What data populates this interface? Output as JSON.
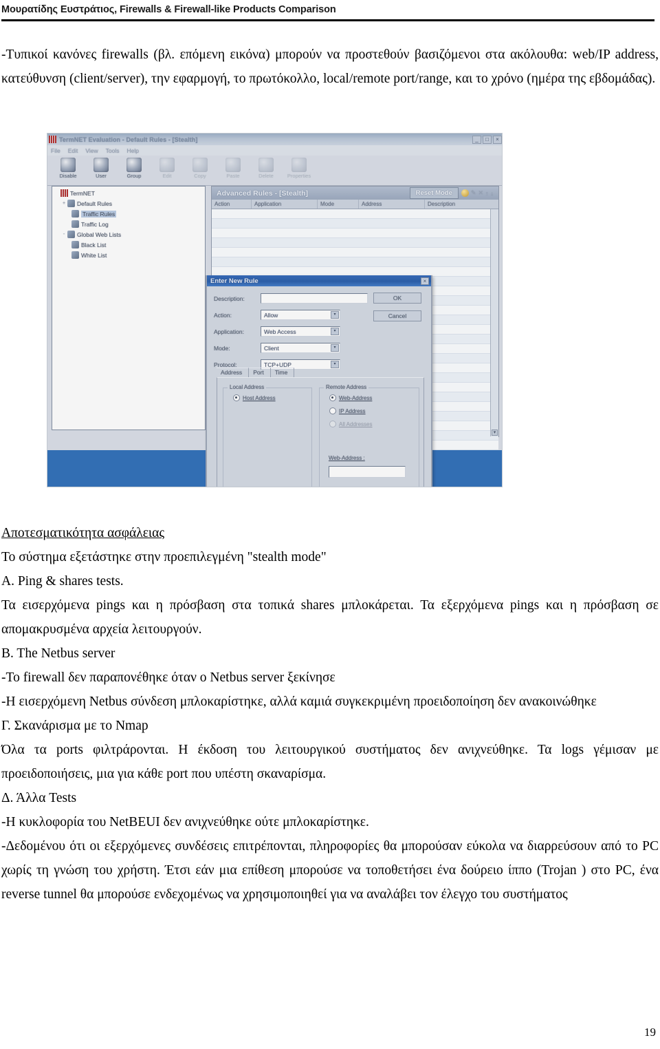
{
  "header": {
    "running_head": "Μουρατίδης Ευστράτιος, Firewalls & Firewall-like Products Comparison"
  },
  "page_number": "19",
  "paragraphs": {
    "intro": "-Τυπικοί κανόνες firewalls (βλ. επόμενη εικόνα) μπορούν να προστεθούν βασιζόμενοι στα ακόλουθα: web/IP address, κατεύθυνση (client/server),  την εφαρμογή, το πρωτόκολλο, local/remote port/range, και το χρόνο (ημέρα της εβδομάδας).",
    "section_security_heading": "Αποτεσματικότητα ασφάλειας",
    "stealth_line": "Το σύστημα εξετάστηκε στην προεπιλεγμένη  \"stealth mode\"",
    "a_heading": "A. Ping & shares tests.",
    "a_body": "Τα εισερχόμενα pings και η πρόσβαση στα τοπικά shares μπλοκάρεται. Τα εξερχόμενα pings και η πρόσβαση σε απομακρυσμένα αρχεία λειτουργούν.",
    "b_heading": "B. The Netbus server",
    "b_line1": "-Το firewall δεν παραπονέθηκε όταν ο Netbus server ξεκίνησε",
    "b_line2": "-Η εισερχόμενη Netbus σύνδεση μπλοκαρίστηκε, αλλά καμιά συγκεκριμένη προειδοποίηση δεν ανακοινώθηκε",
    "c_heading": "Γ. Σκανάρισμα με το Nmap",
    "c_body": "Όλα τα ports φιλτράρονται. Η έκδοση του λειτουργικού συστήματος δεν ανιχνεύθηκε. Τα logs γέμισαν με προειδοποιήσεις, μια για κάθε port που υπέστη σκαναρίσμα.",
    "d_heading": "Δ. Άλλα Tests",
    "d_line1": "-Η κυκλοφορία του NetBEUI δεν ανιχνεύθηκε ούτε μπλοκαρίστηκε.",
    "d_line2": "-Δεδομένου ότι οι εξερχόμενες συνδέσεις επιτρέπονται, πληροφορίες θα μπορούσαν εύκολα να διαρρεύσουν από το PC χωρίς τη γνώση του χρήστη. Έτσι εάν μια επίθεση μπορούσε να τοποθετήσει ένα δούρειο ίππο (Trojan ) στο PC, ένα reverse tunnel θα μπορούσε ενδεχομένως να χρησιμοποιηθεί για να αναλάβει τον έλεγχο του συστήματος"
  },
  "figure": {
    "window": {
      "title": "TermNET Evaluation - Default Rules - [Stealth]",
      "menu": [
        "File",
        "Edit",
        "View",
        "Tools",
        "Help"
      ],
      "caption_buttons": [
        "_",
        "□",
        "×"
      ],
      "toolbar": [
        {
          "label": "Disable",
          "enabled": true
        },
        {
          "label": "User",
          "enabled": true
        },
        {
          "label": "Group",
          "enabled": true
        },
        {
          "label": "Edit",
          "enabled": false
        },
        {
          "label": "Copy",
          "enabled": false
        },
        {
          "label": "Paste",
          "enabled": false
        },
        {
          "label": "Delete",
          "enabled": false
        },
        {
          "label": "Properties",
          "enabled": false
        }
      ]
    },
    "tree": [
      {
        "label": "TermNET",
        "level": 0,
        "selected": false,
        "expander": ""
      },
      {
        "label": "Default Rules",
        "level": 1,
        "selected": false,
        "expander": "+"
      },
      {
        "label": "Traffic Rules",
        "level": 2,
        "selected": true,
        "expander": ""
      },
      {
        "label": "Traffic Log",
        "level": 2,
        "selected": false,
        "expander": ""
      },
      {
        "label": "Global Web Lists",
        "level": 1,
        "selected": false,
        "expander": "-"
      },
      {
        "label": "Black List",
        "level": 2,
        "selected": false,
        "expander": ""
      },
      {
        "label": "White List",
        "level": 2,
        "selected": false,
        "expander": ""
      }
    ],
    "rules_panel": {
      "title": "Advanced Rules - [Stealth]",
      "reset_button": "Reset Mode",
      "tool_icons": [
        "add-rule-icon",
        "edit-icon",
        "delete-icon",
        "move-up-icon",
        "move-down-icon"
      ],
      "columns": [
        "Action",
        "Application",
        "Mode",
        "Address",
        "Description"
      ],
      "rows": []
    },
    "dialog": {
      "title": "Enter New Rule",
      "close_label": "×",
      "fields": [
        {
          "label": "Description:",
          "type": "text",
          "value": ""
        },
        {
          "label": "Action:",
          "type": "combo",
          "value": "Allow"
        },
        {
          "label": "Application:",
          "type": "combo",
          "value": "Web Access"
        },
        {
          "label": "Mode:",
          "type": "combo",
          "value": "Client"
        },
        {
          "label": "Protocol:",
          "type": "combo",
          "value": "TCP+UDP"
        }
      ],
      "buttons": {
        "ok": "OK",
        "cancel": "Cancel"
      },
      "tabs": [
        "Address",
        "Port",
        "Time"
      ],
      "active_tab": "Address",
      "local_group": {
        "title": "Local Address",
        "options": [
          {
            "label": "Host Address",
            "selected": true,
            "enabled": true
          }
        ]
      },
      "remote_group": {
        "title": "Remote Address",
        "options": [
          {
            "label": "Web-Address",
            "selected": true,
            "enabled": true
          },
          {
            "label": "IP Address",
            "selected": false,
            "enabled": true
          },
          {
            "label": "All Addresses",
            "selected": false,
            "enabled": false
          }
        ],
        "web_address_label": "Web-Address :",
        "web_address_value": ""
      }
    },
    "colors": {
      "desktop": "#2b6cb8",
      "dialog_title": "#2f66b8",
      "window_face": "#d4dae4"
    }
  }
}
